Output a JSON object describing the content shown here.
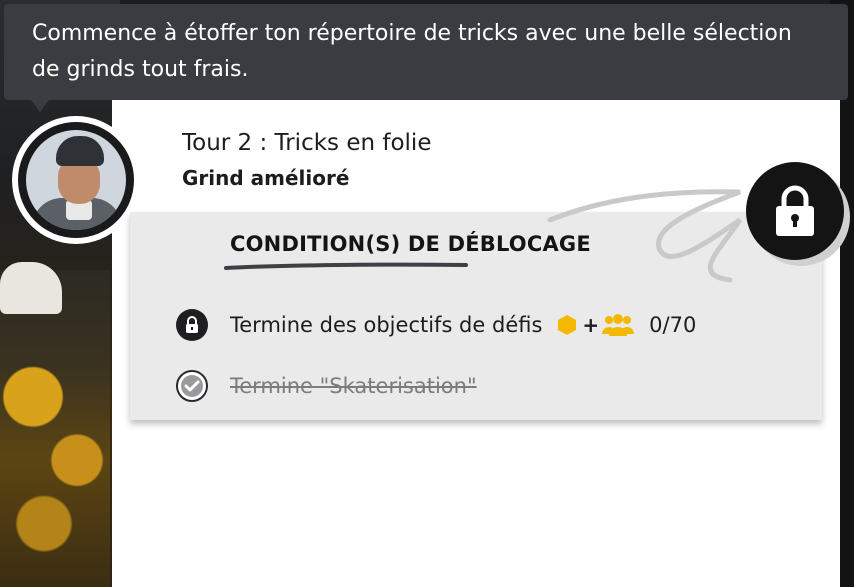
{
  "speech": {
    "text": "Commence à étoffer ton répertoire de tricks avec une belle sélection de grinds tout frais."
  },
  "header": {
    "title": "Tour 2 : Tricks en folie",
    "subtitle": "Grind amélioré"
  },
  "unlock": {
    "heading": "CONDITION(S) DE DÉBLOCAGE",
    "conditions": [
      {
        "icon": "lock-icon",
        "label": "Termine des objectifs de défis",
        "plus": "+",
        "progress": "0/70",
        "completed": false
      },
      {
        "icon": "check-icon",
        "label": "Termine \"Skaterisation\"",
        "completed": true
      }
    ]
  },
  "colors": {
    "bubble": "#3a3c42",
    "panel": "#eaeaea",
    "gold": "#f5b800",
    "badge": "#141414"
  }
}
